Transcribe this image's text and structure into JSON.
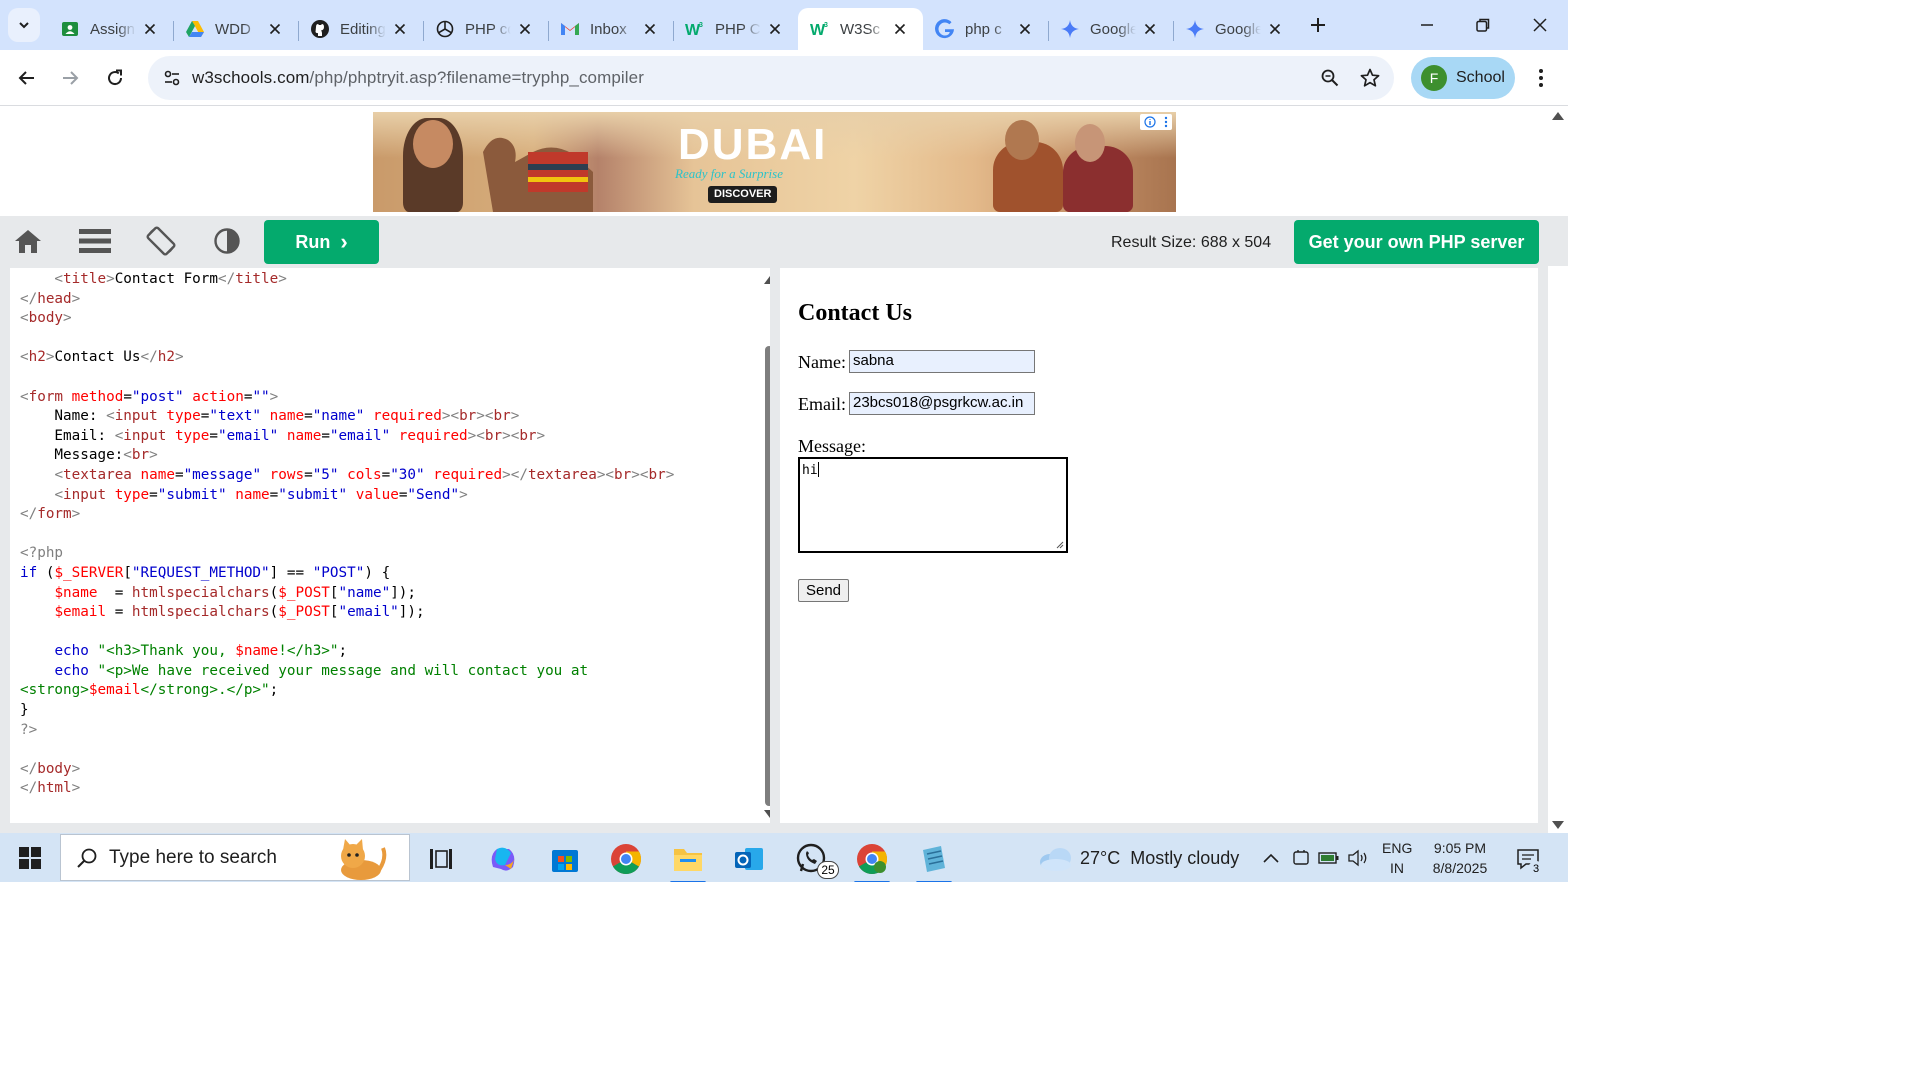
{
  "browser": {
    "tabs": [
      {
        "title": "Assignment",
        "icon": "google-classroom-icon",
        "active": false
      },
      {
        "title": "WDD",
        "icon": "google-drive-icon",
        "active": false
      },
      {
        "title": "Editing",
        "icon": "github-icon",
        "active": false
      },
      {
        "title": "PHP code",
        "icon": "chatgpt-icon",
        "active": false
      },
      {
        "title": "Inbox",
        "icon": "gmail-icon",
        "active": false
      },
      {
        "title": "PHP C",
        "icon": "w3schools-icon",
        "active": false
      },
      {
        "title": "W3Sc",
        "icon": "w3schools-icon",
        "active": true
      },
      {
        "title": "php c",
        "icon": "google-icon",
        "active": false
      },
      {
        "title": "Google",
        "icon": "gemini-icon",
        "active": false
      },
      {
        "title": "Google",
        "icon": "gemini-icon",
        "active": false
      }
    ],
    "url_domain": "w3schools.com",
    "url_path": "/php/phptryit.asp?filename=tryphp_compiler",
    "profile": {
      "initial": "F",
      "label": "School"
    }
  },
  "w3": {
    "run_label": "Run",
    "result_size": "Result Size: 688 x 504",
    "own_server_label": "Get your own PHP server"
  },
  "ad": {
    "logo": "DUBAI",
    "tagline": "Ready for a Surprise",
    "discover": "DISCOVER"
  },
  "code_lines": [
    [
      [
        "t-br",
        "    <"
      ],
      [
        "t-tag",
        "title"
      ],
      [
        "t-br",
        ">"
      ],
      [
        "t-txt",
        "Contact Form"
      ],
      [
        "t-br",
        "</"
      ],
      [
        "t-tag",
        "title"
      ],
      [
        "t-br",
        ">"
      ]
    ],
    [
      [
        "t-br",
        "</"
      ],
      [
        "t-tag",
        "head"
      ],
      [
        "t-br",
        ">"
      ]
    ],
    [
      [
        "t-br",
        "<"
      ],
      [
        "t-tag",
        "body"
      ],
      [
        "t-br",
        ">"
      ]
    ],
    [],
    [
      [
        "t-br",
        "<"
      ],
      [
        "t-tag",
        "h2"
      ],
      [
        "t-br",
        ">"
      ],
      [
        "t-txt",
        "Contact Us"
      ],
      [
        "t-br",
        "</"
      ],
      [
        "t-tag",
        "h2"
      ],
      [
        "t-br",
        ">"
      ]
    ],
    [],
    [
      [
        "t-br",
        "<"
      ],
      [
        "t-tag",
        "form"
      ],
      [
        "t-txt",
        " "
      ],
      [
        "t-attr",
        "method"
      ],
      [
        "t-txt",
        "="
      ],
      [
        "t-val",
        "\"post\""
      ],
      [
        "t-txt",
        " "
      ],
      [
        "t-attr",
        "action"
      ],
      [
        "t-txt",
        "="
      ],
      [
        "t-val",
        "\"\""
      ],
      [
        "t-br",
        ">"
      ]
    ],
    [
      [
        "t-txt",
        "    Name: "
      ],
      [
        "t-br",
        "<"
      ],
      [
        "t-tag",
        "input"
      ],
      [
        "t-txt",
        " "
      ],
      [
        "t-attr",
        "type"
      ],
      [
        "t-txt",
        "="
      ],
      [
        "t-val",
        "\"text\""
      ],
      [
        "t-txt",
        " "
      ],
      [
        "t-attr",
        "name"
      ],
      [
        "t-txt",
        "="
      ],
      [
        "t-val",
        "\"name\""
      ],
      [
        "t-txt",
        " "
      ],
      [
        "t-attr",
        "required"
      ],
      [
        "t-br",
        "><"
      ],
      [
        "t-tag",
        "br"
      ],
      [
        "t-br",
        "><"
      ],
      [
        "t-tag",
        "br"
      ],
      [
        "t-br",
        ">"
      ]
    ],
    [
      [
        "t-txt",
        "    Email: "
      ],
      [
        "t-br",
        "<"
      ],
      [
        "t-tag",
        "input"
      ],
      [
        "t-txt",
        " "
      ],
      [
        "t-attr",
        "type"
      ],
      [
        "t-txt",
        "="
      ],
      [
        "t-val",
        "\"email\""
      ],
      [
        "t-txt",
        " "
      ],
      [
        "t-attr",
        "name"
      ],
      [
        "t-txt",
        "="
      ],
      [
        "t-val",
        "\"email\""
      ],
      [
        "t-txt",
        " "
      ],
      [
        "t-attr",
        "required"
      ],
      [
        "t-br",
        "><"
      ],
      [
        "t-tag",
        "br"
      ],
      [
        "t-br",
        "><"
      ],
      [
        "t-tag",
        "br"
      ],
      [
        "t-br",
        ">"
      ]
    ],
    [
      [
        "t-txt",
        "    Message:"
      ],
      [
        "t-br",
        "<"
      ],
      [
        "t-tag",
        "br"
      ],
      [
        "t-br",
        ">"
      ]
    ],
    [
      [
        "t-txt",
        "    "
      ],
      [
        "t-br",
        "<"
      ],
      [
        "t-tag",
        "textarea"
      ],
      [
        "t-txt",
        " "
      ],
      [
        "t-attr",
        "name"
      ],
      [
        "t-txt",
        "="
      ],
      [
        "t-val",
        "\"message\""
      ],
      [
        "t-txt",
        " "
      ],
      [
        "t-attr",
        "rows"
      ],
      [
        "t-txt",
        "="
      ],
      [
        "t-val",
        "\"5\""
      ],
      [
        "t-txt",
        " "
      ],
      [
        "t-attr",
        "cols"
      ],
      [
        "t-txt",
        "="
      ],
      [
        "t-val",
        "\"30\""
      ],
      [
        "t-txt",
        " "
      ],
      [
        "t-attr",
        "required"
      ],
      [
        "t-br",
        "></"
      ],
      [
        "t-tag",
        "textarea"
      ],
      [
        "t-br",
        "><"
      ],
      [
        "t-tag",
        "br"
      ],
      [
        "t-br",
        "><"
      ],
      [
        "t-tag",
        "br"
      ],
      [
        "t-br",
        ">"
      ]
    ],
    [
      [
        "t-txt",
        "    "
      ],
      [
        "t-br",
        "<"
      ],
      [
        "t-tag",
        "input"
      ],
      [
        "t-txt",
        " "
      ],
      [
        "t-attr",
        "type"
      ],
      [
        "t-txt",
        "="
      ],
      [
        "t-val",
        "\"submit\""
      ],
      [
        "t-txt",
        " "
      ],
      [
        "t-attr",
        "name"
      ],
      [
        "t-txt",
        "="
      ],
      [
        "t-val",
        "\"submit\""
      ],
      [
        "t-txt",
        " "
      ],
      [
        "t-attr",
        "value"
      ],
      [
        "t-txt",
        "="
      ],
      [
        "t-val",
        "\"Send\""
      ],
      [
        "t-br",
        ">"
      ]
    ],
    [
      [
        "t-br",
        "</"
      ],
      [
        "t-tag",
        "form"
      ],
      [
        "t-br",
        ">"
      ]
    ],
    [],
    [
      [
        "t-br",
        "<?php"
      ]
    ],
    [
      [
        "t-kw",
        "if"
      ],
      [
        "t-txt",
        " ("
      ],
      [
        "t-var",
        "$_SERVER"
      ],
      [
        "t-txt",
        "["
      ],
      [
        "t-val",
        "\"REQUEST_METHOD\""
      ],
      [
        "t-txt",
        "] == "
      ],
      [
        "t-val",
        "\"POST\""
      ],
      [
        "t-txt",
        ") {"
      ]
    ],
    [
      [
        "t-txt",
        "    "
      ],
      [
        "t-var",
        "$name"
      ],
      [
        "t-txt",
        "  = "
      ],
      [
        "t-fn",
        "htmlspecialchars"
      ],
      [
        "t-txt",
        "("
      ],
      [
        "t-var",
        "$_POST"
      ],
      [
        "t-txt",
        "["
      ],
      [
        "t-val",
        "\"name\""
      ],
      [
        "t-txt",
        "]);"
      ]
    ],
    [
      [
        "t-txt",
        "    "
      ],
      [
        "t-var",
        "$email"
      ],
      [
        "t-txt",
        " = "
      ],
      [
        "t-fn",
        "htmlspecialchars"
      ],
      [
        "t-txt",
        "("
      ],
      [
        "t-var",
        "$_POST"
      ],
      [
        "t-txt",
        "["
      ],
      [
        "t-val",
        "\"email\""
      ],
      [
        "t-txt",
        "]);"
      ]
    ],
    [],
    [
      [
        "t-txt",
        "    "
      ],
      [
        "t-kw",
        "echo"
      ],
      [
        "t-txt",
        " "
      ],
      [
        "t-str",
        "\"<h3>Thank you, "
      ],
      [
        "t-var",
        "$name"
      ],
      [
        "t-str",
        "!</h3>\""
      ],
      [
        "t-txt",
        ";"
      ]
    ],
    [
      [
        "t-txt",
        "    "
      ],
      [
        "t-kw",
        "echo"
      ],
      [
        "t-txt",
        " "
      ],
      [
        "t-str",
        "\"<p>We have received your message and will contact you at"
      ]
    ],
    [
      [
        "t-str",
        "<strong>"
      ],
      [
        "t-var",
        "$email"
      ],
      [
        "t-str",
        "</strong>.</p>\""
      ],
      [
        "t-txt",
        ";"
      ]
    ],
    [
      [
        "t-txt",
        "}"
      ]
    ],
    [
      [
        "t-br",
        "?>"
      ]
    ],
    [],
    [
      [
        "t-br",
        "</"
      ],
      [
        "t-tag",
        "body"
      ],
      [
        "t-br",
        ">"
      ]
    ],
    [
      [
        "t-br",
        "</"
      ],
      [
        "t-tag",
        "html"
      ],
      [
        "t-br",
        ">"
      ]
    ]
  ],
  "result": {
    "heading": "Contact Us",
    "name_label": "Name:",
    "name_value": "sabna",
    "email_label": "Email:",
    "email_value": "23bcs018@psgrkcw.ac.in",
    "message_label": "Message:",
    "message_value": "hi",
    "send_label": "Send"
  },
  "taskbar": {
    "search_placeholder": "Type here to search",
    "whatsapp_badge": "25",
    "weather_temp": "27°C",
    "weather_desc": "Mostly cloudy",
    "lang_1": "ENG",
    "lang_2": "IN",
    "time": "9:05 PM",
    "date": "8/8/2025",
    "notification_count": "3"
  }
}
